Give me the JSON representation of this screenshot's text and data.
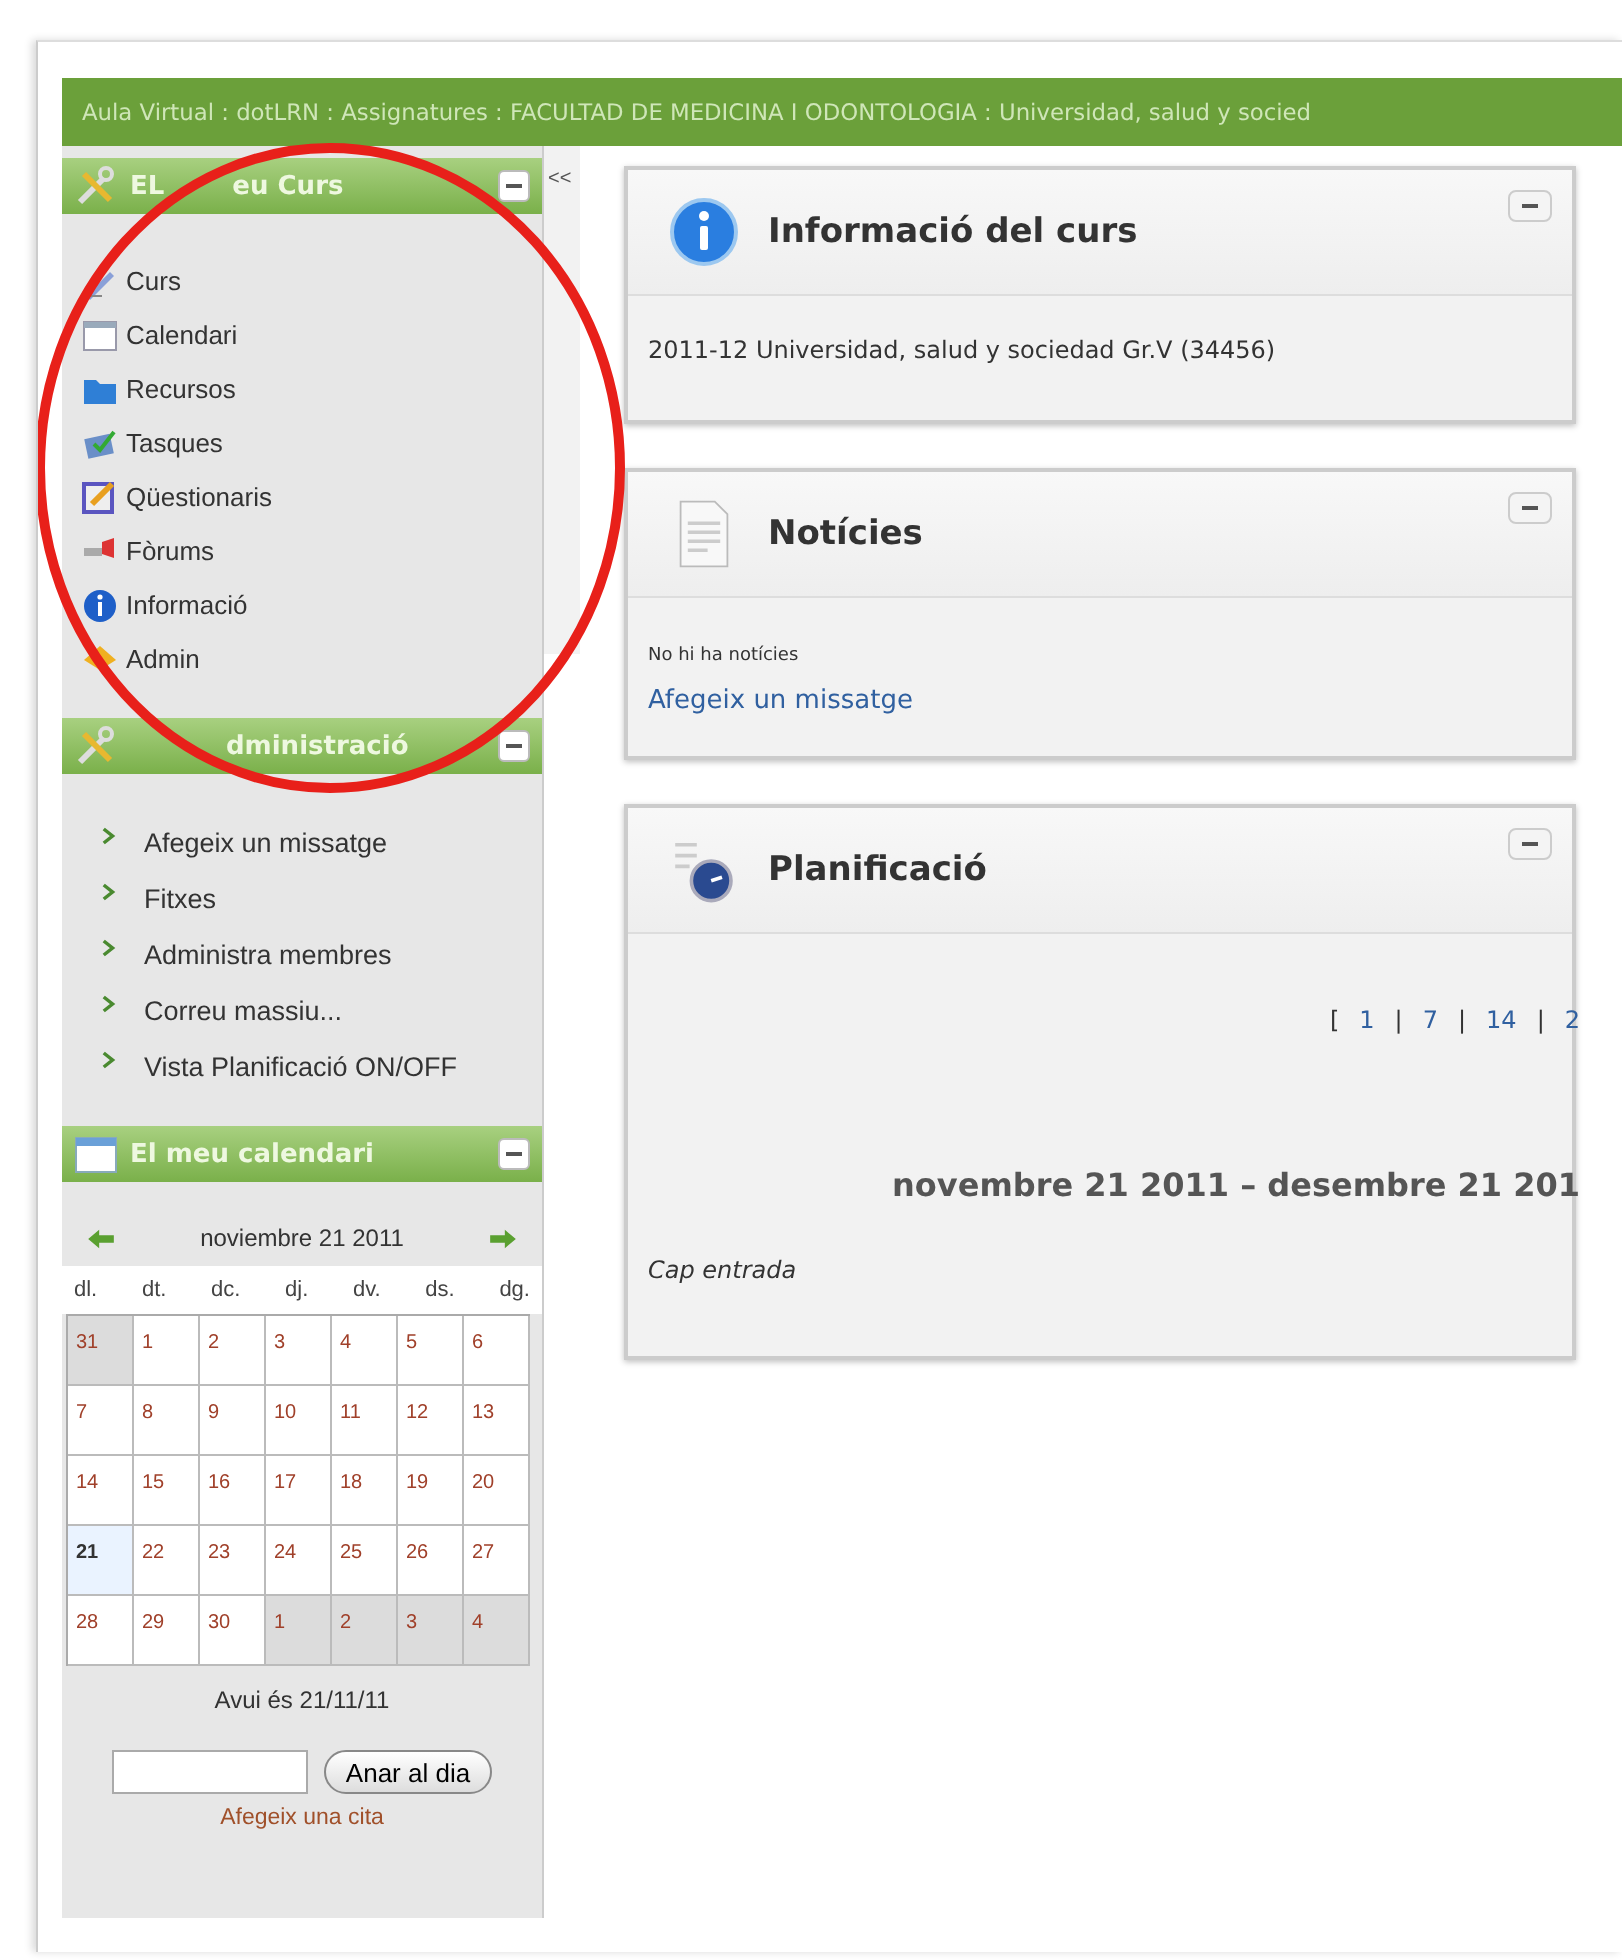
{
  "breadcrumb": "Aula Virtual : dotLRN : Assignatures : FACULTAD DE MEDICINA I ODONTOLOGIA : Universidad, salud y socied",
  "collapse_button": "<<",
  "course_menu": {
    "title": [
      "EL",
      "eu Curs"
    ],
    "items": [
      {
        "label": "Curs"
      },
      {
        "label": "Calendari"
      },
      {
        "label": "Recursos"
      },
      {
        "label": "Tasques"
      },
      {
        "label": "Qüestionaris"
      },
      {
        "label": "Fòrums"
      },
      {
        "label": "Informació"
      },
      {
        "label": "Admin"
      }
    ]
  },
  "admin_menu": {
    "title": [
      "dministració"
    ],
    "items": [
      {
        "label": "Afegeix un missatge"
      },
      {
        "label": "Fitxes"
      },
      {
        "label": "Administra membres"
      },
      {
        "label": "Correu massiu..."
      },
      {
        "label": "Vista Planificació ON/OFF"
      }
    ]
  },
  "calendar": {
    "title": "El meu calendari",
    "month": "noviembre 21 2011",
    "weekdays": [
      "dl.",
      "dt.",
      "dc.",
      "dj.",
      "dv.",
      "ds.",
      "dg."
    ],
    "weeks": [
      [
        {
          "day": "31",
          "other_month": true,
          "today": false
        },
        {
          "day": "1",
          "other_month": false,
          "today": false
        },
        {
          "day": "2",
          "other_month": false,
          "today": false
        },
        {
          "day": "3",
          "other_month": false,
          "today": false
        },
        {
          "day": "4",
          "other_month": false,
          "today": false
        },
        {
          "day": "5",
          "other_month": false,
          "today": false
        },
        {
          "day": "6",
          "other_month": false,
          "today": false
        }
      ],
      [
        {
          "day": "7",
          "other_month": false,
          "today": false
        },
        {
          "day": "8",
          "other_month": false,
          "today": false
        },
        {
          "day": "9",
          "other_month": false,
          "today": false
        },
        {
          "day": "10",
          "other_month": false,
          "today": false
        },
        {
          "day": "11",
          "other_month": false,
          "today": false
        },
        {
          "day": "12",
          "other_month": false,
          "today": false
        },
        {
          "day": "13",
          "other_month": false,
          "today": false
        }
      ],
      [
        {
          "day": "14",
          "other_month": false,
          "today": false
        },
        {
          "day": "15",
          "other_month": false,
          "today": false
        },
        {
          "day": "16",
          "other_month": false,
          "today": false
        },
        {
          "day": "17",
          "other_month": false,
          "today": false
        },
        {
          "day": "18",
          "other_month": false,
          "today": false
        },
        {
          "day": "19",
          "other_month": false,
          "today": false
        },
        {
          "day": "20",
          "other_month": false,
          "today": false
        }
      ],
      [
        {
          "day": "21",
          "other_month": false,
          "today": true
        },
        {
          "day": "22",
          "other_month": false,
          "today": false
        },
        {
          "day": "23",
          "other_month": false,
          "today": false
        },
        {
          "day": "24",
          "other_month": false,
          "today": false
        },
        {
          "day": "25",
          "other_month": false,
          "today": false
        },
        {
          "day": "26",
          "other_month": false,
          "today": false
        },
        {
          "day": "27",
          "other_month": false,
          "today": false
        }
      ],
      [
        {
          "day": "28",
          "other_month": false,
          "today": false
        },
        {
          "day": "29",
          "other_month": false,
          "today": false
        },
        {
          "day": "30",
          "other_month": false,
          "today": false
        },
        {
          "day": "1",
          "other_month": true,
          "today": false
        },
        {
          "day": "2",
          "other_month": true,
          "today": false
        },
        {
          "day": "3",
          "other_month": true,
          "today": false
        },
        {
          "day": "4",
          "other_month": true,
          "today": false
        }
      ]
    ],
    "today_text": "Avui és 21/11/11",
    "go_button": "Anar al dia",
    "add_link": "Afegeix una cita"
  },
  "panels": [
    {
      "kind": "info",
      "title": "Informació del curs",
      "text": "2011-12 Universidad, salud y sociedad Gr.V (34456)"
    },
    {
      "kind": "news",
      "title": "Notícies",
      "text": "No hi ha notícies",
      "link": "Afegeix un missatge"
    },
    {
      "kind": "planning",
      "title": "Planificació",
      "pager": [
        "[",
        "1",
        "|",
        "7",
        "|",
        "14",
        "|",
        "2"
      ],
      "range": "novembre 21 2011 – desembre 21 201",
      "text": "Cap entrada"
    }
  ]
}
